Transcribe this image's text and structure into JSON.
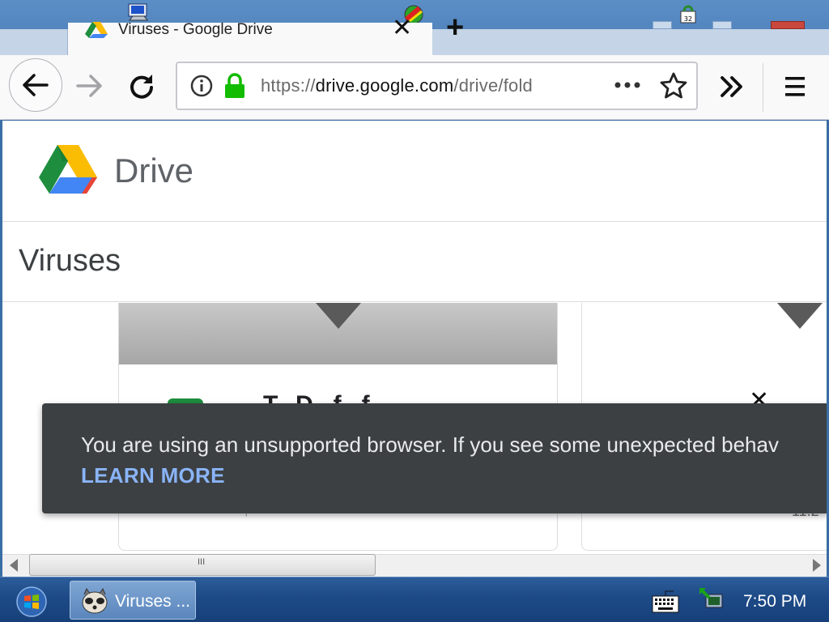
{
  "browser": {
    "tab": {
      "title": "Viruses - Google Drive",
      "close_symbol": "✕",
      "new_tab_symbol": "+"
    },
    "url_bar": {
      "url_prefix": "https://",
      "url_domain": "drive.google.com",
      "url_suffix": "/drive/fold",
      "page_actions_symbol": "•••"
    }
  },
  "page": {
    "app_name": "Drive",
    "folder_title": "Viruses",
    "card_left_name": "T.. D.. f.. f..",
    "card_left_meta": "'",
    "card_right_meta": "11.2",
    "snackbar": {
      "message": "You are using an unsupported browser. If you see some unexpected behav",
      "action": "LEARN MORE",
      "close_symbol": "✕"
    }
  },
  "scrollbar": {
    "grip_symbol": "III"
  },
  "taskbar": {
    "app_label": "Viruses ...",
    "clock": "7:50 PM"
  },
  "colors": {
    "drive_green": "#1e8e3e",
    "drive_blue": "#4285f4",
    "drive_yellow": "#fbbc04",
    "drive_red": "#ea4335",
    "lock_green": "#12bc00",
    "snackbar_bg": "#3c4043",
    "snackbar_link": "#8ab4f8"
  },
  "icons": [
    "back-icon",
    "forward-icon",
    "reload-icon",
    "info-icon",
    "lock-icon",
    "star-icon",
    "chevrons-icon",
    "hamburger-icon",
    "drive-logo-icon",
    "windows-logo-icon",
    "keyboard-icon",
    "network-icon"
  ]
}
